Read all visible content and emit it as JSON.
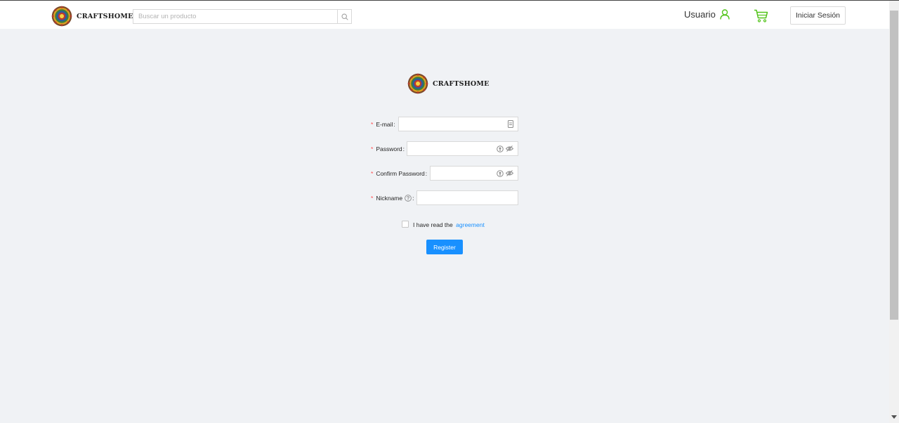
{
  "header": {
    "brand_name": "CRAFTSHOME",
    "search_placeholder": "Buscar un producto",
    "user_label": "Usuario",
    "login_label": "Iniciar Sesión"
  },
  "register": {
    "brand_name": "CRAFTSHOME",
    "email_label": "E-mail",
    "password_label": "Password",
    "confirm_password_label": "Confirm Password",
    "nickname_label": "Nickname",
    "agreement_text": "I have read the",
    "agreement_link": "agreement",
    "submit_label": "Register"
  },
  "colors": {
    "primary": "#1890ff",
    "required": "#ff4d4f",
    "user_icon": "#52c41a",
    "background": "#f0f2f5"
  },
  "icons": [
    "search-icon",
    "user-icon",
    "cart-icon",
    "email-clipboard-icon",
    "password-manager-icon",
    "eye-hidden-icon",
    "question-circle-icon"
  ]
}
